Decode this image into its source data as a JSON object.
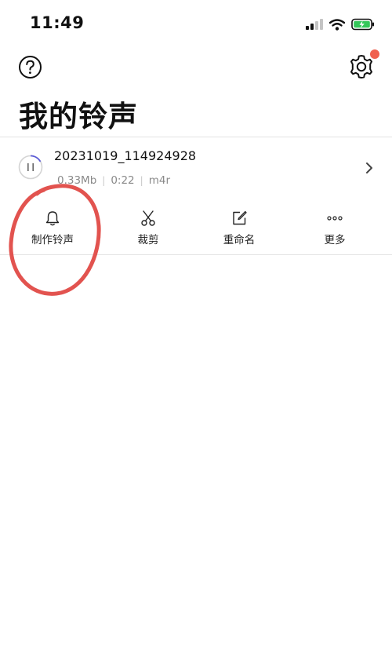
{
  "status_bar": {
    "time": "11:49",
    "icons": [
      "signal-icon",
      "wifi-icon",
      "battery-charging-icon"
    ],
    "battery_color": "#34c759"
  },
  "header": {
    "help_icon": "question-icon",
    "settings_icon": "gear-icon",
    "settings_badge_color": "#f0614f",
    "title": "我的铃声"
  },
  "recording": {
    "name": "20231019_114924928",
    "size": "0.33Mb",
    "duration": "0:22",
    "format": "m4r",
    "separator": "|"
  },
  "actions": [
    {
      "label": "制作铃声",
      "icon": "bell-icon"
    },
    {
      "label": "裁剪",
      "icon": "scissors-icon"
    },
    {
      "label": "重命名",
      "icon": "edit-icon"
    },
    {
      "label": "更多",
      "icon": "more-icon"
    }
  ],
  "annotation": {
    "color": "#e2534f"
  }
}
